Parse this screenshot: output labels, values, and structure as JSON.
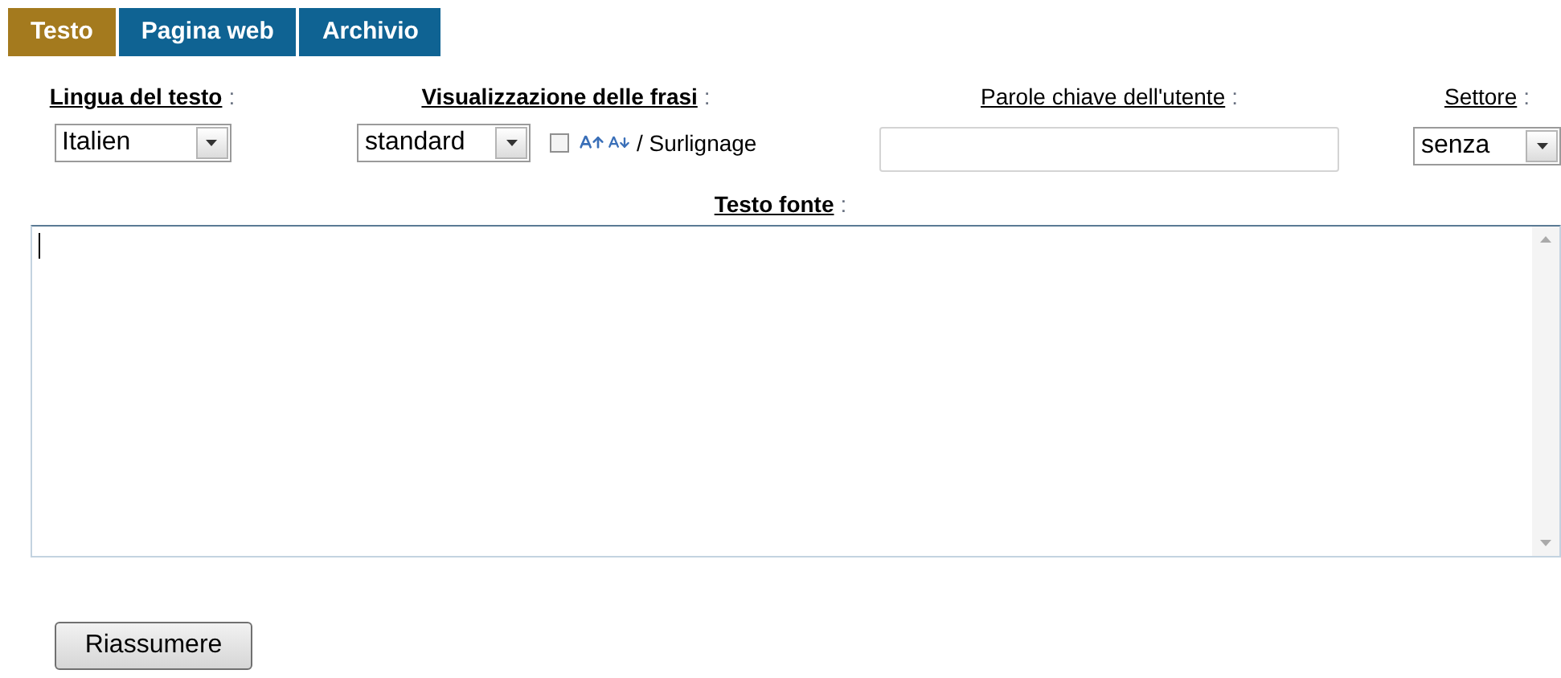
{
  "tabs": [
    {
      "label": "Testo",
      "selected": true
    },
    {
      "label": "Pagina web",
      "selected": false
    },
    {
      "label": "Archivio",
      "selected": false
    }
  ],
  "options": {
    "language": {
      "label": "Lingua del testo",
      "suffix": ":",
      "bold": true,
      "value": "Italien"
    },
    "display": {
      "label": "Visualizzazione delle frasi",
      "suffix": ":",
      "bold": true,
      "value": "standard",
      "highlight_checked": false,
      "highlight_label": "/ Surlignage"
    },
    "keywords": {
      "label": "Parole chiave dell'utente",
      "suffix": ":",
      "bold": false
    },
    "sector": {
      "label": "Settore",
      "suffix": ":",
      "bold": false,
      "value": "senza"
    }
  },
  "source": {
    "label": "Testo fonte",
    "suffix": ":",
    "bold": true
  },
  "buttons": [
    "Riassumere"
  ]
}
